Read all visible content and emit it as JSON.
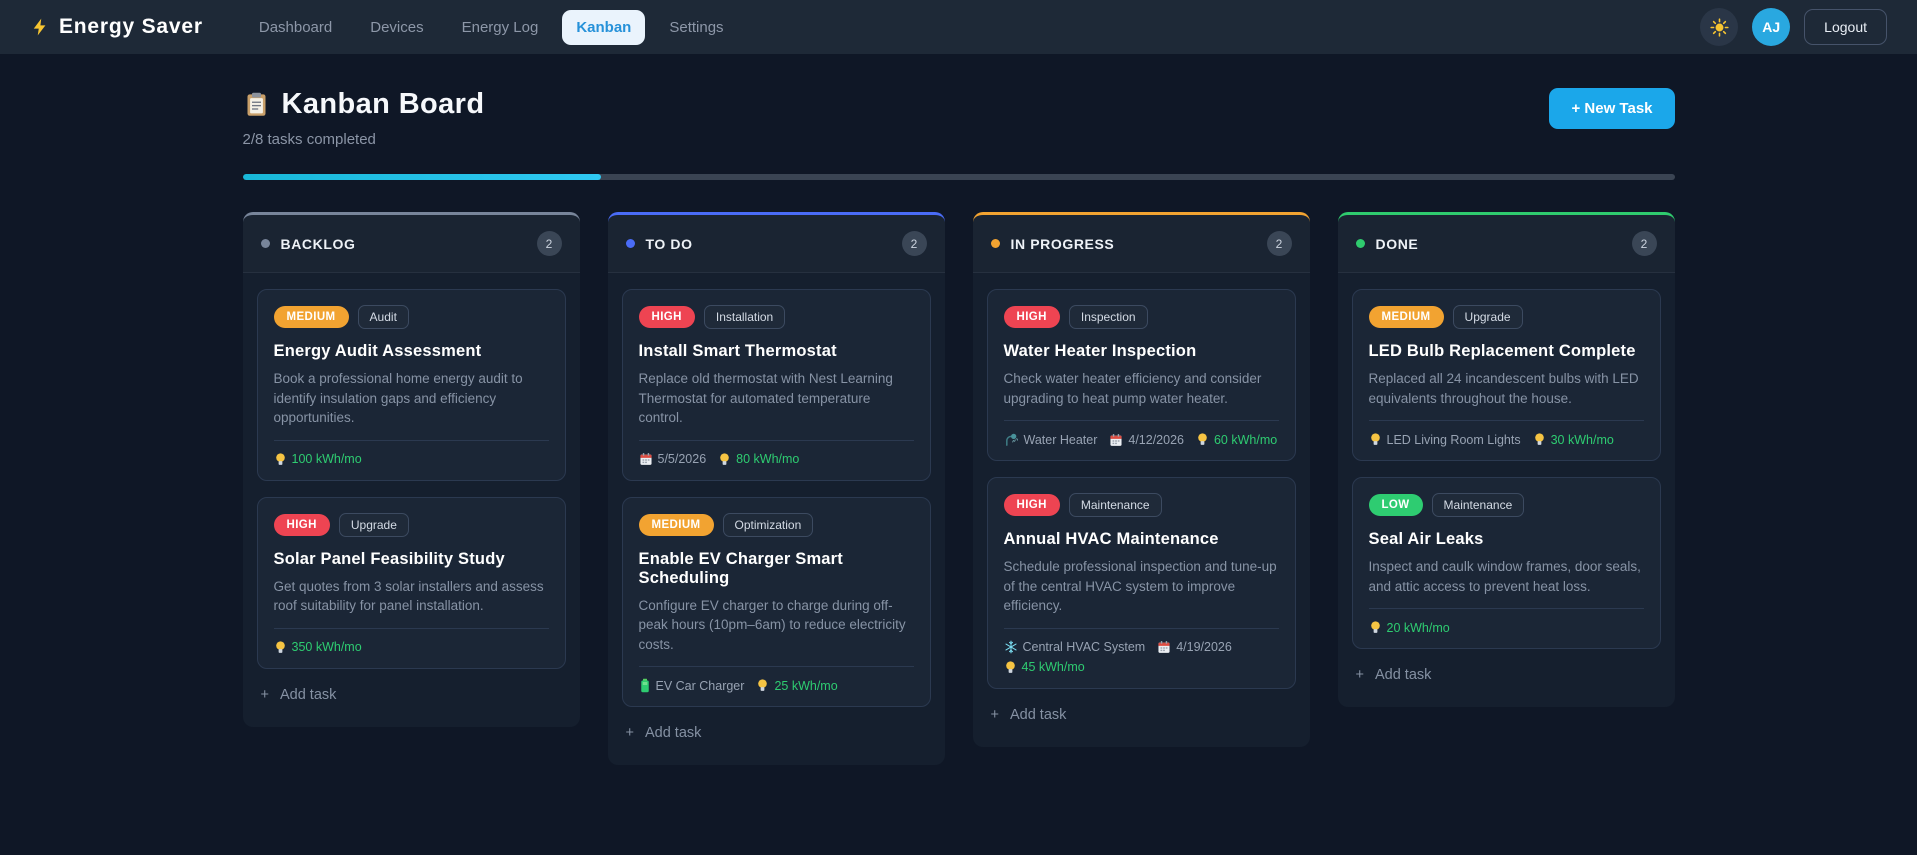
{
  "navbar": {
    "logo_icon": "bolt-icon",
    "logo_text": "Energy Saver",
    "links": [
      {
        "label": "Dashboard",
        "active": false
      },
      {
        "label": "Devices",
        "active": false
      },
      {
        "label": "Energy Log",
        "active": false
      },
      {
        "label": "Kanban",
        "active": true
      },
      {
        "label": "Settings",
        "active": false
      }
    ],
    "theme_toggle_icon": "sun-icon",
    "avatar_initials": "AJ",
    "logout_label": "Logout"
  },
  "header": {
    "icon": "clipboard-icon",
    "title": "Kanban Board",
    "subtitle": "2/8 tasks completed",
    "new_task_label": "+ New Task",
    "progress_percent": 25,
    "progress_colors": [
      "#18b8d8",
      "#2fc9f2"
    ]
  },
  "colors": {
    "priority": {
      "HIGH": "#ee4452",
      "MEDIUM": "#f2a331",
      "LOW": "#2ecc71"
    },
    "energy_green": "#2ecc71"
  },
  "board": {
    "add_task_plus": "+",
    "add_task_label": "Add task",
    "columns": [
      {
        "name": "BACKLOG",
        "count": "2",
        "accent": "#78859a",
        "tasks": [
          {
            "priority": "MEDIUM",
            "tag": "Audit",
            "title": "Energy Audit Assessment",
            "description": "Book a professional home energy audit to identify insulation gaps and efficiency opportunities.",
            "meta": [
              {
                "icon": "bulb-icon",
                "text": "100 kWh/mo",
                "kind": "energy"
              }
            ]
          },
          {
            "priority": "HIGH",
            "tag": "Upgrade",
            "title": "Solar Panel Feasibility Study",
            "description": "Get quotes from 3 solar installers and assess roof suitability for panel installation.",
            "meta": [
              {
                "icon": "bulb-icon",
                "text": "350 kWh/mo",
                "kind": "energy"
              }
            ]
          }
        ]
      },
      {
        "name": "TO DO",
        "count": "2",
        "accent": "#4a6cf7",
        "tasks": [
          {
            "priority": "HIGH",
            "tag": "Installation",
            "title": "Install Smart Thermostat",
            "description": "Replace old thermostat with Nest Learning Thermostat for automated temperature control.",
            "meta": [
              {
                "icon": "calendar-icon",
                "text": "5/5/2026",
                "kind": "date"
              },
              {
                "icon": "bulb-icon",
                "text": "80 kWh/mo",
                "kind": "energy"
              }
            ]
          },
          {
            "priority": "MEDIUM",
            "tag": "Optimization",
            "title": "Enable EV Charger Smart Scheduling",
            "description": "Configure EV charger to charge during off-peak hours (10pm–6am) to reduce electricity costs.",
            "meta": [
              {
                "icon": "battery-icon",
                "text": "EV Car Charger",
                "kind": "device"
              },
              {
                "icon": "bulb-icon",
                "text": "25 kWh/mo",
                "kind": "energy"
              }
            ]
          }
        ]
      },
      {
        "name": "IN PROGRESS",
        "count": "2",
        "accent": "#f2a331",
        "tasks": [
          {
            "priority": "HIGH",
            "tag": "Inspection",
            "title": "Water Heater Inspection",
            "description": "Check water heater efficiency and consider upgrading to heat pump water heater.",
            "meta": [
              {
                "icon": "shower-icon",
                "text": "Water Heater",
                "kind": "device"
              },
              {
                "icon": "calendar-icon",
                "text": "4/12/2026",
                "kind": "date"
              },
              {
                "icon": "bulb-icon",
                "text": "60 kWh/mo",
                "kind": "energy"
              }
            ]
          },
          {
            "priority": "HIGH",
            "tag": "Maintenance",
            "title": "Annual HVAC Maintenance",
            "description": "Schedule professional inspection and tune-up of the central HVAC system to improve efficiency.",
            "meta": [
              {
                "icon": "snowflake-icon",
                "text": "Central HVAC System",
                "kind": "device"
              },
              {
                "icon": "calendar-icon",
                "text": "4/19/2026",
                "kind": "date"
              },
              {
                "icon": "bulb-icon",
                "text": "45 kWh/mo",
                "kind": "energy"
              }
            ]
          }
        ]
      },
      {
        "name": "DONE",
        "count": "2",
        "accent": "#2fcb6e",
        "tasks": [
          {
            "priority": "MEDIUM",
            "tag": "Upgrade",
            "title": "LED Bulb Replacement Complete",
            "description": "Replaced all 24 incandescent bulbs with LED equivalents throughout the house.",
            "meta": [
              {
                "icon": "bulb-icon",
                "text": "LED Living Room Lights",
                "kind": "device"
              },
              {
                "icon": "bulb-icon",
                "text": "30 kWh/mo",
                "kind": "energy"
              }
            ]
          },
          {
            "priority": "LOW",
            "tag": "Maintenance",
            "title": "Seal Air Leaks",
            "description": "Inspect and caulk window frames, door seals, and attic access to prevent heat loss.",
            "meta": [
              {
                "icon": "bulb-icon",
                "text": "20 kWh/mo",
                "kind": "energy"
              }
            ]
          }
        ]
      }
    ]
  }
}
